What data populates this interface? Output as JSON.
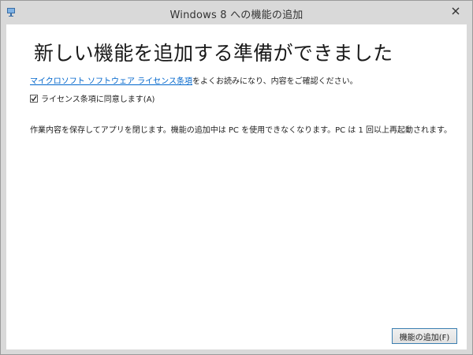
{
  "window": {
    "title": "Windows 8 への機能の追加",
    "app_icon": "add-features-icon",
    "close_icon": "close-icon"
  },
  "main": {
    "heading": "新しい機能を追加する準備ができました",
    "license_link": "マイクロソフト ソフトウェア ライセンス条項",
    "license_suffix": "をよくお読みになり、内容をご確認ください。",
    "agree_checked": true,
    "agree_label": "ライセンス条項に同意します(A)",
    "info_text": "作業内容を保存してアプリを閉じます。機能の追加中は PC を使用できなくなります。PC は 1 回以上再起動されます。"
  },
  "footer": {
    "add_features_label": "機能の追加(F)"
  },
  "colors": {
    "titlebar": "#d9d9d9",
    "link": "#0066cc",
    "button_border": "#3c7fb1"
  }
}
